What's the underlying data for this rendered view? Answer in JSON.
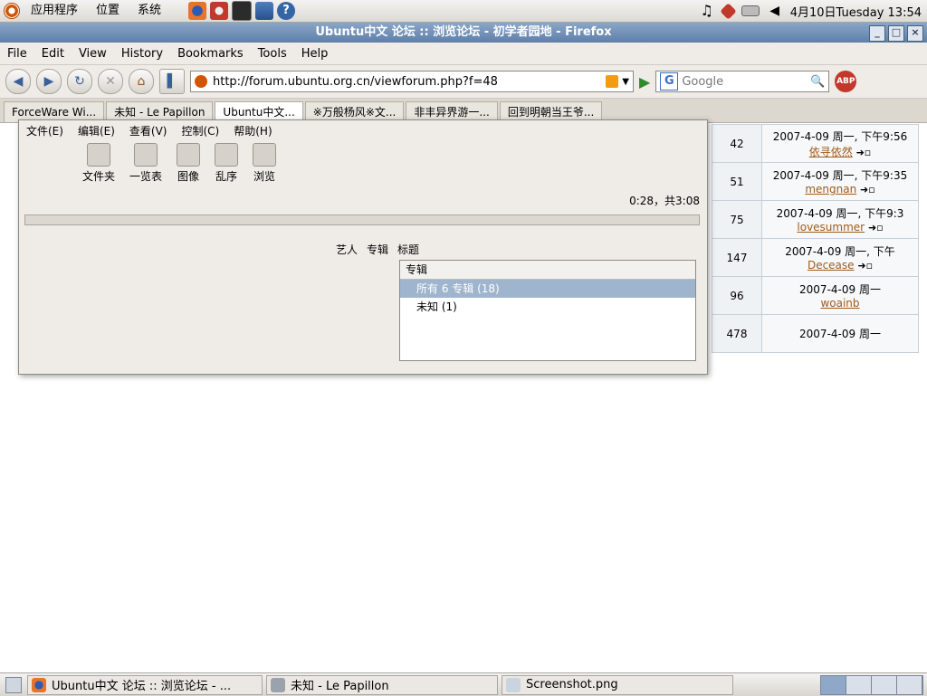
{
  "top_panel": {
    "applications": "应用程序",
    "places": "位置",
    "system": "系统",
    "clock": "4月10日Tuesday 13:54",
    "launcher_icons": [
      "firefox-icon",
      "mail-icon",
      "terminal-icon",
      "network-icon",
      "help-icon"
    ],
    "tray_icons": [
      "music-note-icon",
      "gem-icon",
      "battery-icon",
      "volume-icon"
    ]
  },
  "window": {
    "title": "Ubuntu中文 论坛 :: 浏览论坛 - 初学者园地 - Firefox",
    "menu": [
      "File",
      "Edit",
      "View",
      "History",
      "Bookmarks",
      "Tools",
      "Help"
    ],
    "url": "http://forum.ubuntu.org.cn/viewforum.php?f=48",
    "search_placeholder": "Google",
    "tabs": [
      "ForceWare Wi...",
      "未知 - Le Papillon",
      "Ubuntu中文...",
      "※万般杨风※文...",
      "非丰异界游一...",
      "回到明朝当王爷..."
    ]
  },
  "forum_rows": [
    {
      "replies": "42",
      "date": "2007-4-09 周一, 下午9:56",
      "poster": "依寻依然"
    },
    {
      "replies": "51",
      "date": "2007-4-09 周一, 下午9:35",
      "poster": "mengnan"
    },
    {
      "replies": "75",
      "date": "2007-4-09 周一, 下午9:3",
      "poster": "lovesummer"
    },
    {
      "replies": "147",
      "date": "2007-4-09 周一, 下午",
      "poster": "Decease"
    },
    {
      "replies": "96",
      "date": "2007-4-09 周一",
      "poster": "woainb"
    },
    {
      "replies": "478",
      "date": "2007-4-09 周一",
      "poster": ""
    }
  ],
  "player": {
    "menu": [
      "文件(E)",
      "编辑(E)",
      "查看(V)",
      "控制(C)",
      "帮助(H)"
    ],
    "tools": [
      "文件夹",
      "一览表",
      "图像",
      "乱序",
      "浏览"
    ],
    "time": "0:28，共3:08",
    "columns": [
      "艺人",
      "专辑",
      "标题"
    ],
    "list_header": "专辑",
    "list_rows": [
      "所有 6 专辑 (18)",
      "未知 (1)"
    ]
  },
  "taskbar": {
    "items": [
      "Ubuntu中文 论坛 :: 浏览论坛 - ...",
      "未知 - Le Papillon",
      "Screenshot.png"
    ]
  }
}
